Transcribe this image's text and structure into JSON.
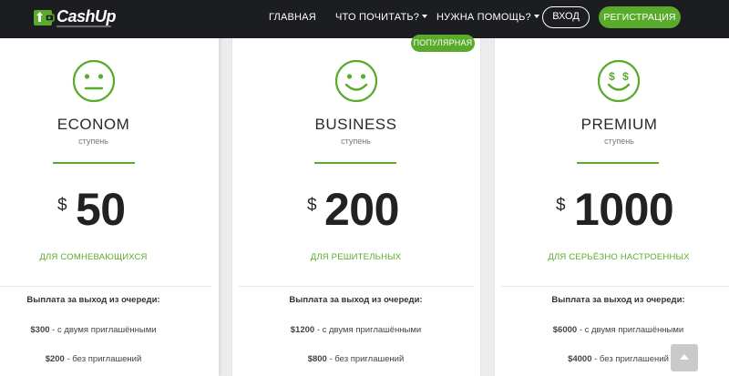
{
  "header": {
    "logo_text": "CashUp",
    "nav": [
      {
        "label": "ГЛАВНАЯ"
      },
      {
        "label": "ЧТО ПОЧИТАТЬ?"
      },
      {
        "label": "НУЖНА ПОМОЩЬ?"
      }
    ],
    "login_label": "ВХОД",
    "register_label": "РЕГИСТРАЦИЯ"
  },
  "popular_badge": "ПОПУЛЯРНАЯ",
  "plans": [
    {
      "name": "ECONOM",
      "sub": "ступень",
      "currency": "$",
      "price": "50",
      "audience": "ДЛЯ СОМНЕВАЮЩИХСЯ",
      "payout_title": "Выплата за выход из очереди:",
      "payouts": [
        {
          "amount": "$300",
          "text": " - с двумя приглашёнными"
        },
        {
          "amount": "$200",
          "text": " - без приглашений"
        }
      ],
      "icon": "neutral-face-icon"
    },
    {
      "name": "BUSINESS",
      "sub": "ступень",
      "currency": "$",
      "price": "200",
      "audience": "ДЛЯ РЕШИТЕЛЬНЫХ",
      "payout_title": "Выплата за выход из очереди:",
      "payouts": [
        {
          "amount": "$1200",
          "text": " - с двумя приглашёнными"
        },
        {
          "amount": "$800",
          "text": " - без приглашений"
        }
      ],
      "icon": "smile-face-icon"
    },
    {
      "name": "PREMIUM",
      "sub": "ступень",
      "currency": "$",
      "price": "1000",
      "audience": "ДЛЯ СЕРЬЁЗНО НАСТРОЕННЫХ",
      "payout_title": "Выплата за выход из очереди:",
      "payouts": [
        {
          "amount": "$6000",
          "text": " - с двумя приглашёнными"
        },
        {
          "amount": "$4000",
          "text": " - без приглашений"
        }
      ],
      "icon": "dollar-eyes-face-icon"
    }
  ],
  "colors": {
    "accent": "#5aab2c",
    "header_bg": "#1c1d21"
  }
}
